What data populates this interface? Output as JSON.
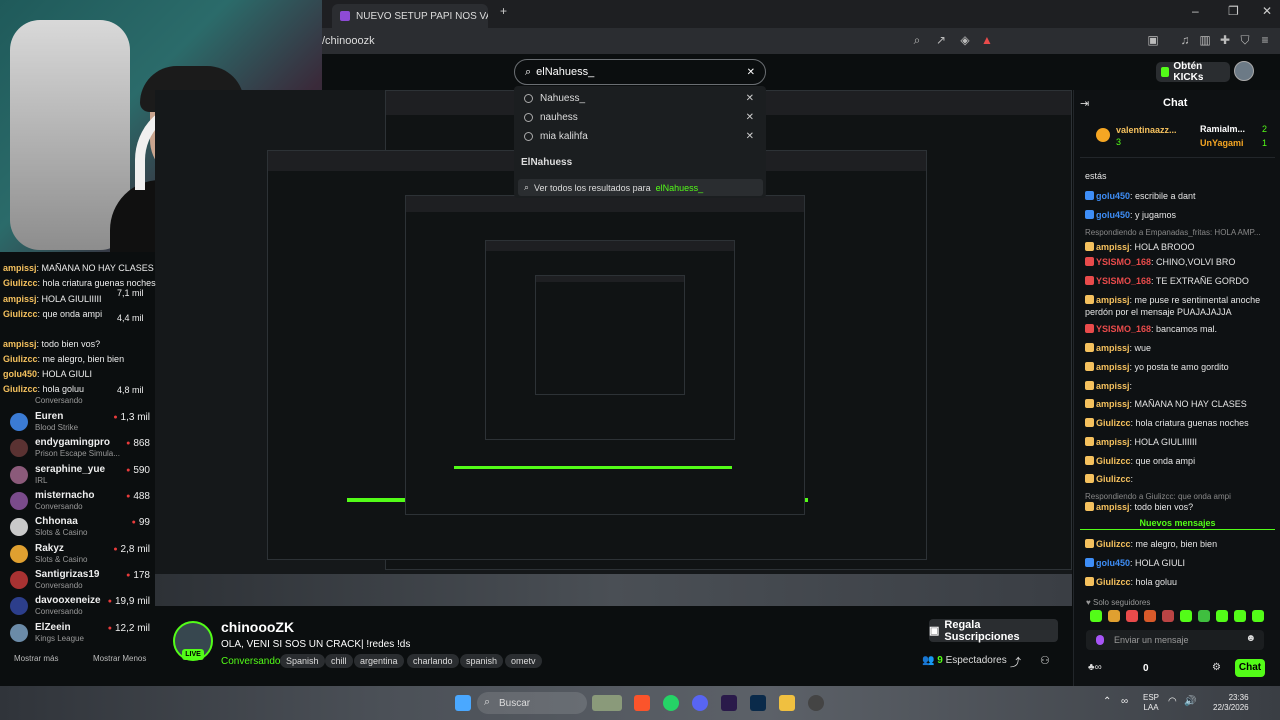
{
  "browser": {
    "tab_title": "NUEVO SETUP PAPI NOS VAMOS A C",
    "new_tab": "+",
    "address": "/chinooozk",
    "win_min": "–",
    "win_max": "❐",
    "win_close": "✕"
  },
  "header": {
    "search_value": "elNahuess_",
    "get_kicks": "Obtén KICKs"
  },
  "dropdown": {
    "recent": [
      "Nahuess_",
      "nauhess",
      "mia kalihfa"
    ],
    "section": "ElNahuess",
    "see_all_prefix": "Ver todos los resultados para",
    "see_all_term": "elNahuess_"
  },
  "overlay_chat": [
    {
      "user": "ampissj",
      "text": ": MAÑANA NO HAY CLASES"
    },
    {
      "user": "Giulizcc",
      "text": ": hola criatura guenas noches"
    },
    {
      "user": "ampissj",
      "text": ": HOLA GIULIIIII"
    },
    {
      "user": "Giulizcc",
      "text": ": que onda ampi"
    },
    {
      "user": "ampissj",
      "text": ": todo bien vos?"
    },
    {
      "user": "Giulizcc",
      "text": ": me alegro, bien bien"
    },
    {
      "user": "golu450",
      "text": ": HOLA GIULI"
    },
    {
      "user": "Giulizcc",
      "text": ": hola goluu"
    }
  ],
  "overlay_viewers": [
    "7,1 mil",
    "4,4 mil",
    "4,8 mil"
  ],
  "overlay_cat": "Conversando",
  "channels": [
    {
      "name": "Euren",
      "category": "Blood Strike",
      "viewers": "1,3 mil"
    },
    {
      "name": "endygamingpro",
      "category": "Prison Escape Simula...",
      "viewers": "868"
    },
    {
      "name": "seraphine_yue",
      "category": "IRL",
      "viewers": "590"
    },
    {
      "name": "misternacho",
      "category": "Conversando",
      "viewers": "488"
    },
    {
      "name": "Chhonaa",
      "category": "Slots & Casino",
      "viewers": "99"
    },
    {
      "name": "Rakyz",
      "category": "Slots & Casino",
      "viewers": "2,8 mil"
    },
    {
      "name": "Santigrizas19",
      "category": "Conversando",
      "viewers": "178"
    },
    {
      "name": "davooxeneize",
      "category": "Conversando",
      "viewers": "19,9 mil"
    },
    {
      "name": "ElZeein",
      "category": "Kings League",
      "viewers": "12,2 mil"
    }
  ],
  "sidebar_buttons": {
    "more": "Mostrar más",
    "less": "Mostrar Menos"
  },
  "stream": {
    "live": "LIVE",
    "channel": "chinoooZK",
    "title": "OLA, VENI SI SOS UN CRACK| !redes !ds",
    "category": "Conversando",
    "tags": [
      "Spanish",
      "chill",
      "argentina",
      "charlando",
      "spanish",
      "ometv"
    ],
    "gift": "Regala Suscripciones",
    "viewers_count": "9",
    "viewers_label": "Espectadores"
  },
  "chat": {
    "title": "Chat",
    "pinned": [
      {
        "user": "valentinaazz...",
        "count": "3"
      },
      {
        "user": "Ramialm...",
        "count": "2"
      },
      {
        "user": "UnYagami",
        "count": "1"
      }
    ],
    "top_line": "estás",
    "messages": [
      {
        "user": "golu450",
        "text": ": escribile a dant",
        "color": "#3e8ef7"
      },
      {
        "user": "golu450",
        "text": ": y jugamos",
        "color": "#3e8ef7"
      },
      {
        "reply": "Respondiendo a Empanadas_fritas: HOLA AMP..."
      },
      {
        "user": "ampissj",
        "text": ": HOLA BROOO",
        "color": "#f5c15e"
      },
      {
        "user": "YSISMO_168",
        "text": ": CHINO,VOLVI BRO",
        "color": "#e94b4b"
      },
      {
        "user": "YSISMO_168",
        "text": ": TE EXTRAÑE GORDO",
        "color": "#e94b4b"
      },
      {
        "user": "ampissj",
        "text": ": me puse re sentimental anoche perdón por el mensaje PUAJAJAJJA",
        "color": "#f5c15e"
      },
      {
        "user": "YSISMO_168",
        "text": ": bancamos mal.",
        "color": "#e94b4b"
      },
      {
        "user": "ampissj",
        "text": ": wue",
        "color": "#f5c15e"
      },
      {
        "user": "ampissj",
        "text": ": yo posta te amo gordito",
        "color": "#f5c15e"
      },
      {
        "user": "ampissj",
        "text": ":",
        "color": "#f5c15e"
      },
      {
        "user": "ampissj",
        "text": ": MAÑANA NO HAY CLASES",
        "color": "#f5c15e"
      },
      {
        "user": "Giulizcc",
        "text": ": hola criatura guenas noches",
        "color": "#f5c15e"
      },
      {
        "user": "ampissj",
        "text": ": HOLA GIULIIIIII",
        "color": "#f5c15e"
      },
      {
        "user": "Giulizcc",
        "text": ": que onda ampi",
        "color": "#f5c15e"
      },
      {
        "user": "Giulizcc",
        "text": ":",
        "color": "#f5c15e"
      },
      {
        "reply": "Respondiendo a Giulizcc: que onda ampi"
      },
      {
        "user": "ampissj",
        "text": ": todo bien vos?",
        "color": "#f5c15e"
      }
    ],
    "new_messages": "Nuevos mensajes",
    "new": [
      {
        "user": "Giulizcc",
        "text": ": me alegro, bien bien",
        "color": "#f5c15e"
      },
      {
        "user": "golu450",
        "text": ": HOLA GIULI",
        "color": "#3e8ef7"
      },
      {
        "user": "Giulizcc",
        "text": ": hola goluu",
        "color": "#f5c15e"
      }
    ],
    "followers_only": "Solo seguidores",
    "input_placeholder": "Enviar un mensaje",
    "kicks": "0",
    "send": "Chat"
  },
  "taskbar": {
    "search": "Buscar",
    "lang1": "ESP",
    "lang2": "LAA",
    "time": "23:36",
    "date": "22/3/2026"
  }
}
